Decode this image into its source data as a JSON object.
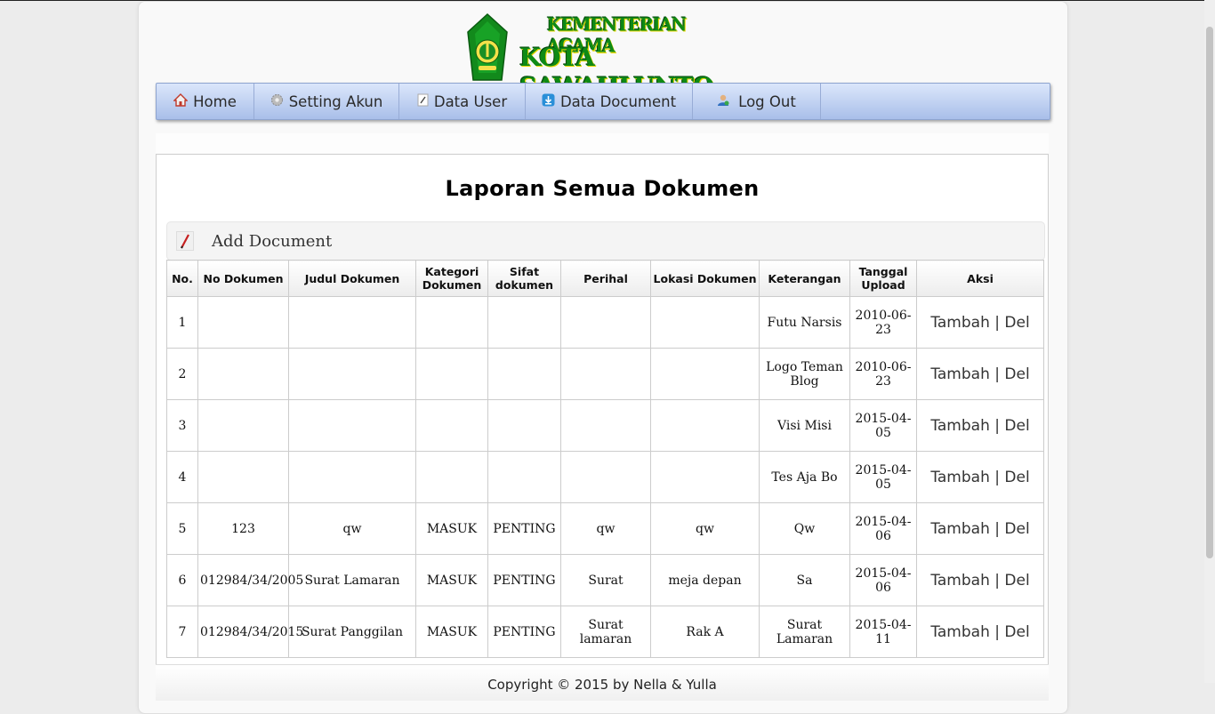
{
  "header": {
    "logo_line1": "KEMENTERIAN AGAMA",
    "logo_line2": "KOTA SAWAHLUNTO"
  },
  "nav": {
    "items": [
      {
        "label": "Home",
        "icon": "home-icon"
      },
      {
        "label": "Setting Akun",
        "icon": "gear-icon"
      },
      {
        "label": "Data User",
        "icon": "edit-icon"
      },
      {
        "label": "Data Document",
        "icon": "download-icon"
      },
      {
        "label": "Log Out",
        "icon": "user-icon"
      }
    ]
  },
  "page": {
    "title": "Laporan Semua Dokumen",
    "add_label": "Add Document"
  },
  "table": {
    "headers": [
      "No.",
      "No Dokumen",
      "Judul Dokumen",
      "Kategori Dokumen",
      "Sifat dokumen",
      "Perihal",
      "Lokasi Dokumen",
      "Keterangan",
      "Tanggal Upload",
      "Aksi"
    ],
    "rows": [
      {
        "no": "1",
        "no_dokumen": "",
        "judul": "",
        "kategori": "",
        "sifat": "",
        "perihal": "",
        "lokasi": "",
        "keterangan": "Futu Narsis",
        "tanggal": "2010-06-23"
      },
      {
        "no": "2",
        "no_dokumen": "",
        "judul": "",
        "kategori": "",
        "sifat": "",
        "perihal": "",
        "lokasi": "",
        "keterangan": "Logo Teman Blog",
        "tanggal": "2010-06-23"
      },
      {
        "no": "3",
        "no_dokumen": "",
        "judul": "",
        "kategori": "",
        "sifat": "",
        "perihal": "",
        "lokasi": "",
        "keterangan": "Visi Misi",
        "tanggal": "2015-04-05"
      },
      {
        "no": "4",
        "no_dokumen": "",
        "judul": "",
        "kategori": "",
        "sifat": "",
        "perihal": "",
        "lokasi": "",
        "keterangan": "Tes Aja Bo",
        "tanggal": "2015-04-05"
      },
      {
        "no": "5",
        "no_dokumen": "123",
        "judul": "qw",
        "kategori": "MASUK",
        "sifat": "PENTING",
        "perihal": "qw",
        "lokasi": "qw",
        "keterangan": "Qw",
        "tanggal": "2015-04-06"
      },
      {
        "no": "6",
        "no_dokumen": "012984/34/2005",
        "judul": "Surat Lamaran",
        "kategori": "MASUK",
        "sifat": "PENTING",
        "perihal": "Surat",
        "lokasi": "meja depan",
        "keterangan": "Sa",
        "tanggal": "2015-04-06"
      },
      {
        "no": "7",
        "no_dokumen": "012984/34/2015",
        "judul": "Surat Panggilan",
        "kategori": "MASUK",
        "sifat": "PENTING",
        "perihal": "Surat lamaran",
        "lokasi": "Rak A",
        "keterangan": "Surat Lamaran",
        "tanggal": "2015-04-11"
      }
    ],
    "action_add": "Tambah",
    "action_sep": "|",
    "action_del": "Del"
  },
  "footer": {
    "text": "Copyright © 2015 by Nella & Yulla"
  }
}
